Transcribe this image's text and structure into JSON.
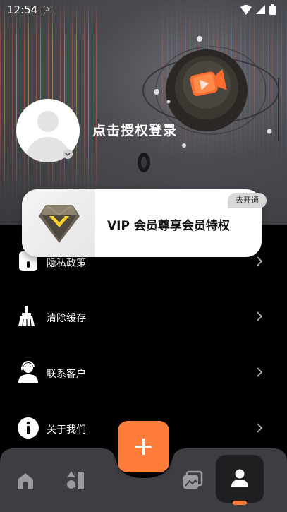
{
  "status_bar": {
    "time": "12:54",
    "badge": "A"
  },
  "profile": {
    "login_prompt": "点击授权登录"
  },
  "vip": {
    "title": "VIP 会员尊享会员特权",
    "open_label": "去开通"
  },
  "menu": [
    {
      "label": "隐私政策",
      "icon": "privacy-icon"
    },
    {
      "label": "清除缓存",
      "icon": "broom-icon"
    },
    {
      "label": "联系客户",
      "icon": "customer-service-icon"
    },
    {
      "label": "关于我们",
      "icon": "info-icon"
    }
  ],
  "bottom_nav": {
    "items": [
      "home-icon",
      "shapes-icon",
      "gallery-icon",
      "profile-icon"
    ],
    "active": "profile-icon"
  },
  "colors": {
    "accent": "#ff7d3b",
    "nav_bg": "#3e3d42",
    "card_bg": "#ffffff"
  }
}
